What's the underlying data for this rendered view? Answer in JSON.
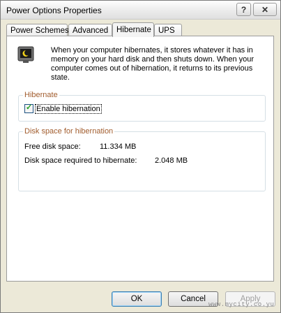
{
  "window": {
    "title": "Power Options Properties",
    "help_glyph": "?",
    "close_glyph": "✕"
  },
  "tabs": [
    {
      "label": "Power Schemes",
      "active": false
    },
    {
      "label": "Advanced",
      "active": false
    },
    {
      "label": "Hibernate",
      "active": true
    },
    {
      "label": "UPS",
      "active": false
    }
  ],
  "hibernate": {
    "icon": "hibernate-monitor-icon",
    "description": "When your computer hibernates, it stores whatever it has in memory on your hard disk and then shuts down. When your computer comes out of hibernation, it returns to its previous state.",
    "group_title": "Hibernate",
    "enable_label": "Enable hibernation",
    "enable_checked": true
  },
  "disk_space": {
    "group_title": "Disk space for hibernation",
    "free_label": "Free disk space:",
    "free_value": "11.334 MB",
    "required_label": "Disk space required to hibernate:",
    "required_value": "2.048 MB"
  },
  "buttons": {
    "ok": "OK",
    "cancel": "Cancel",
    "apply": "Apply"
  },
  "watermark": "www.mycity.co.yu",
  "colors": {
    "group_title": "#a15c2d",
    "ok_border": "#3c7fb1"
  }
}
